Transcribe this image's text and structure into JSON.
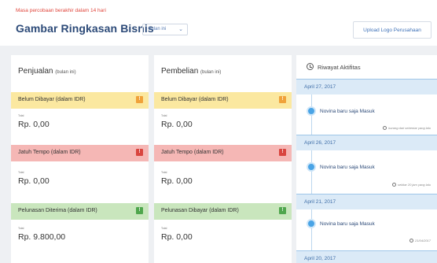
{
  "header": {
    "trial_notice": "Masa percobaan berakhir dalam 14 hari",
    "title": "Gambar Ringkasan Bisnis",
    "period_select": "bulan ini",
    "upload_logo": "Upload Logo Perusahaan"
  },
  "sales": {
    "title": "Penjualan",
    "subtitle": "(bulan ini)",
    "cards": [
      {
        "label": "Belum Dibayar (dalam IDR)",
        "total_label": "Total",
        "amount": "Rp. 0,00",
        "badge": "!"
      },
      {
        "label": "Jatuh Tempo (dalam IDR)",
        "total_label": "Total",
        "amount": "Rp. 0,00",
        "badge": "!"
      },
      {
        "label": "Pelunasan Diterima (dalam IDR)",
        "total_label": "Total",
        "amount": "Rp. 9.800,00",
        "badge": "!"
      }
    ]
  },
  "purchases": {
    "title": "Pembelian",
    "subtitle": "(bulan ini)",
    "cards": [
      {
        "label": "Belum Dibayar (dalam IDR)",
        "total_label": "Total",
        "amount": "Rp. 0,00",
        "badge": "!"
      },
      {
        "label": "Jatuh Tempo (dalam IDR)",
        "total_label": "Total",
        "amount": "Rp. 0,00",
        "badge": "!"
      },
      {
        "label": "Pelunasan Dibayar (dalam IDR)",
        "total_label": "Total",
        "amount": "Rp. 0,00",
        "badge": "!"
      }
    ]
  },
  "activity": {
    "title": "Riwayat Aktifitas",
    "groups": [
      {
        "date": "April 27, 2017",
        "text": "Novina baru saja Masuk",
        "meta": "kurang dari sebentar yang lalu"
      },
      {
        "date": "April 26, 2017",
        "text": "Novina baru saja Masuk",
        "meta": "sekitar 20 jam yang lalu"
      },
      {
        "date": "April 21, 2017",
        "text": "Novina baru saja Masuk",
        "meta": "21/04/2017"
      },
      {
        "date": "April 20, 2017"
      }
    ]
  },
  "colors": {
    "title": "#2c4a78",
    "trial": "#e0463c",
    "yellow": "#fbe8a0",
    "red": "#f5b7b5",
    "green": "#c9e6bd",
    "timeline": "#4aa4e6"
  }
}
